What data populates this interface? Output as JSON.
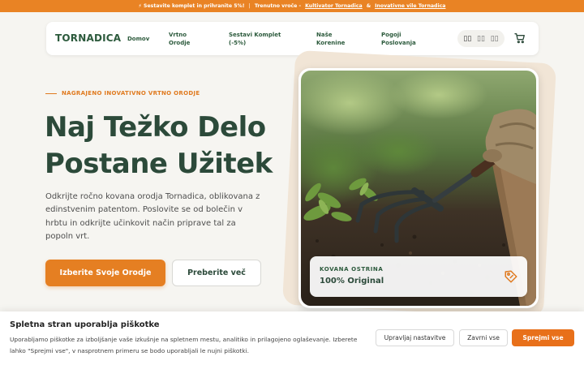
{
  "promo": {
    "part1": "⚡ Sestavite komplet in prihranite 5%!",
    "separator": "|",
    "part2": "Trenutno vroče -",
    "link1": "Kultivator Tornadica",
    "amp": "&",
    "link2": "Inovativne vile Tornadica"
  },
  "nav": {
    "logo": "TORNADICA",
    "links": [
      {
        "label": "Domov"
      },
      {
        "label": "Vrtno\nOrodje"
      },
      {
        "label": "Sestavi Komplet\n(-5%)"
      },
      {
        "label": "Naše\nKorenine"
      },
      {
        "label": "Pogoji\nPoslovanja"
      }
    ],
    "languages": [
      "▯▯",
      "▯▯",
      "▯▯"
    ],
    "cart_icon": "cart-icon"
  },
  "hero": {
    "eyebrow": "NAGRAJENO INOVATIVNO VRTNO ORODJE",
    "title_line1": "Naj Težko Delo",
    "title_line2": "Postane Užitek",
    "description": "Odkrijte ročno kovana orodja Tornadica, oblikovana z edinstvenim patentom. Poslovite se od bolečin v hrbtu in odkrijte učinkovit način priprave tal za popoln vrt.",
    "primary_button": "Izberite Svoje Orodje",
    "secondary_button": "Preberite več",
    "badge_label": "KOVANA OSTRINA",
    "badge_value": "100% Original",
    "badge_icon": "tag-icon",
    "accent_color": "#e57f22",
    "brand_color": "#2c5a3c"
  },
  "cookie": {
    "title": "Spletna stran uporablja piškotke",
    "text": "Uporabljamo piškotke za izboljšanje vaše izkušnje na spletnem mestu, analitiko in prilagojeno oglaševanje. Izberete lahko \"Sprejmi vse\", v nasprotnem primeru se bodo uporabljali le nujni piškotki.",
    "manage": "Upravljaj nastavitve",
    "reject": "Zavrni vse",
    "accept": "Sprejmi vse"
  }
}
